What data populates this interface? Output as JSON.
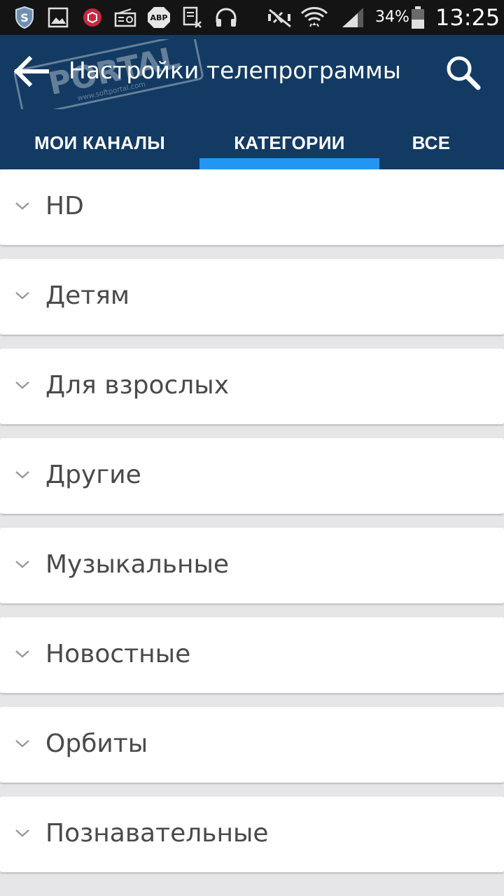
{
  "status_bar": {
    "battery_percent": "34%",
    "time": "13:25",
    "abp_label": "ABP",
    "icons": [
      "shield-icon",
      "gallery-icon",
      "security-app-icon",
      "radio-icon",
      "adblock-icon",
      "document-icon",
      "headphones-icon",
      "mute-icon",
      "wifi-icon",
      "signal-icon",
      "battery-icon"
    ]
  },
  "watermark": {
    "text": "PORTAL",
    "subtext": "www.softportal.com"
  },
  "app_bar": {
    "title": "Настройки телепрограммы",
    "back_icon": "arrow-back-icon",
    "search_icon": "search-icon"
  },
  "tabs": [
    {
      "label": "МОИ КАНАЛЫ",
      "selected": false
    },
    {
      "label": "КАТЕГОРИИ",
      "selected": true
    },
    {
      "label": "ВСЕ",
      "selected": false
    }
  ],
  "categories": [
    {
      "label": "HD"
    },
    {
      "label": "Детям"
    },
    {
      "label": "Для взрослых"
    },
    {
      "label": "Другие"
    },
    {
      "label": "Музыкальные"
    },
    {
      "label": "Новостные"
    },
    {
      "label": "Орбиты"
    },
    {
      "label": "Познавательные"
    }
  ],
  "colors": {
    "app_bar": "#123a63",
    "tab_indicator": "#2196f3",
    "status_bar": "#141414",
    "background": "#e6e6e8"
  }
}
